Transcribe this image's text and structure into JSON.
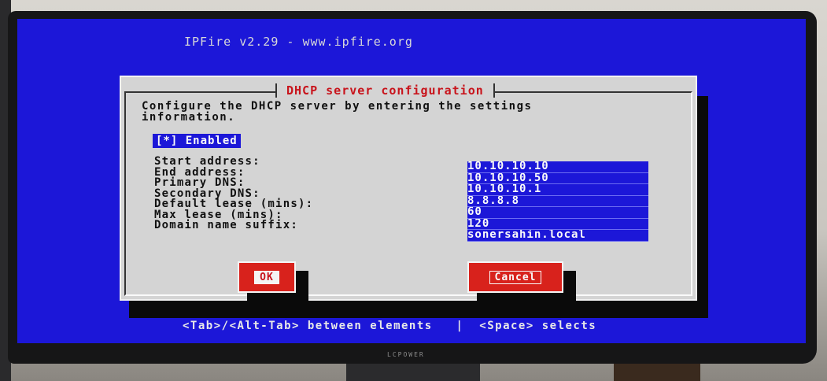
{
  "header": {
    "title": "IPFire v2.29 - www.ipfire.org"
  },
  "dialog": {
    "title": "DHCP server configuration",
    "intro": "Configure the DHCP server by entering the settings\ninformation.",
    "enabled_checkbox": "[*] Enabled",
    "fields": [
      {
        "label": "Start address:",
        "value": "10.10.10.10"
      },
      {
        "label": "End address:",
        "value": "10.10.10.50"
      },
      {
        "label": "Primary DNS:",
        "value": "10.10.10.1"
      },
      {
        "label": "Secondary DNS:",
        "value": "8.8.8.8"
      },
      {
        "label": "Default lease (mins):",
        "value": "60"
      },
      {
        "label": "Max lease (mins):",
        "value": "120"
      },
      {
        "label": "Domain name suffix:",
        "value": "sonersahin.local"
      }
    ],
    "ok_label": "OK",
    "cancel_label": "Cancel"
  },
  "footer": {
    "hint": "<Tab>/<Alt-Tab> between elements   |  <Space> selects"
  },
  "monitor": {
    "brand": "LCPOWER"
  },
  "colors": {
    "screen_bg": "#1c17d8",
    "dialog_bg": "#d4d4d4",
    "title_red": "#c8141c",
    "button_red": "#d8221c"
  }
}
